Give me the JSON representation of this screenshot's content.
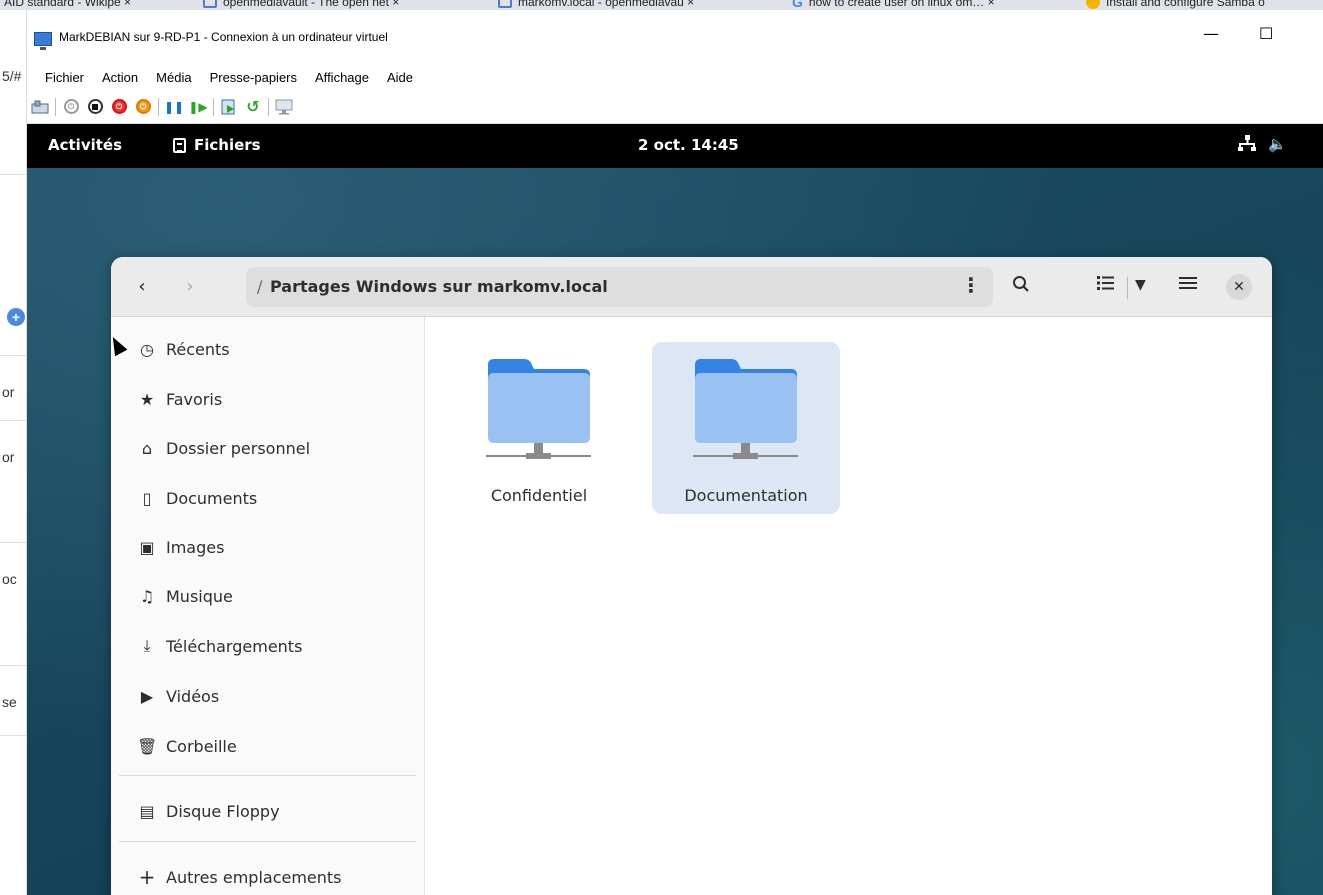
{
  "browser_tabs": [
    {
      "label": "AID standard - Wikipé ×"
    },
    {
      "label": "openmediavault - The open net ×"
    },
    {
      "label": "markomv.local - openmediavau ×"
    },
    {
      "label": "how to create user on linux om… ×"
    },
    {
      "label": "Install and configure Samba o"
    }
  ],
  "browser_edge": {
    "fragments": [
      "5/#",
      "or",
      "or",
      "oc",
      "se"
    ],
    "add_icon": "plus-circle-icon"
  },
  "vm_window": {
    "title": "MarkDEBIAN sur 9-RD-P1 - Connexion à un ordinateur virtuel",
    "minimize_glyph": "—",
    "maximize_glyph": "☐",
    "menu": [
      "Fichier",
      "Action",
      "Média",
      "Presse-papiers",
      "Affichage",
      "Aide"
    ],
    "toolbar_icons": [
      "ctrl-alt-del-icon",
      "start-icon",
      "turn-off-icon",
      "shutdown-icon",
      "save-icon",
      "pause-icon",
      "resume-icon",
      "checkpoint-icon",
      "revert-icon",
      "enhanced-session-icon"
    ]
  },
  "gnome_topbar": {
    "activities": "Activités",
    "app_name": "Fichiers",
    "clock": "2 oct. 14:45"
  },
  "files": {
    "path": "Partages Windows sur markomv.local",
    "path_prefix": "/",
    "sidebar": [
      {
        "label": "Récents",
        "icon": "clock-icon"
      },
      {
        "label": "Favoris",
        "icon": "star-icon"
      },
      {
        "label": "Dossier personnel",
        "icon": "home-icon"
      },
      {
        "label": "Documents",
        "icon": "document-icon"
      },
      {
        "label": "Images",
        "icon": "image-icon"
      },
      {
        "label": "Musique",
        "icon": "music-icon"
      },
      {
        "label": "Téléchargements",
        "icon": "download-icon"
      },
      {
        "label": "Vidéos",
        "icon": "video-icon"
      },
      {
        "label": "Corbeille",
        "icon": "trash-icon"
      },
      {
        "label": "Disque Floppy",
        "icon": "floppy-icon"
      },
      {
        "label": "Autres emplacements",
        "icon": "plus-icon"
      }
    ],
    "shares": [
      {
        "label": "Confidentiel",
        "selected": false
      },
      {
        "label": "Documentation",
        "selected": true
      }
    ],
    "colors": {
      "accent": "#3584e4",
      "selected_tile": "#dce6f5",
      "folder_light": "#99c1f1",
      "folder_dark": "#62a0ea"
    }
  }
}
